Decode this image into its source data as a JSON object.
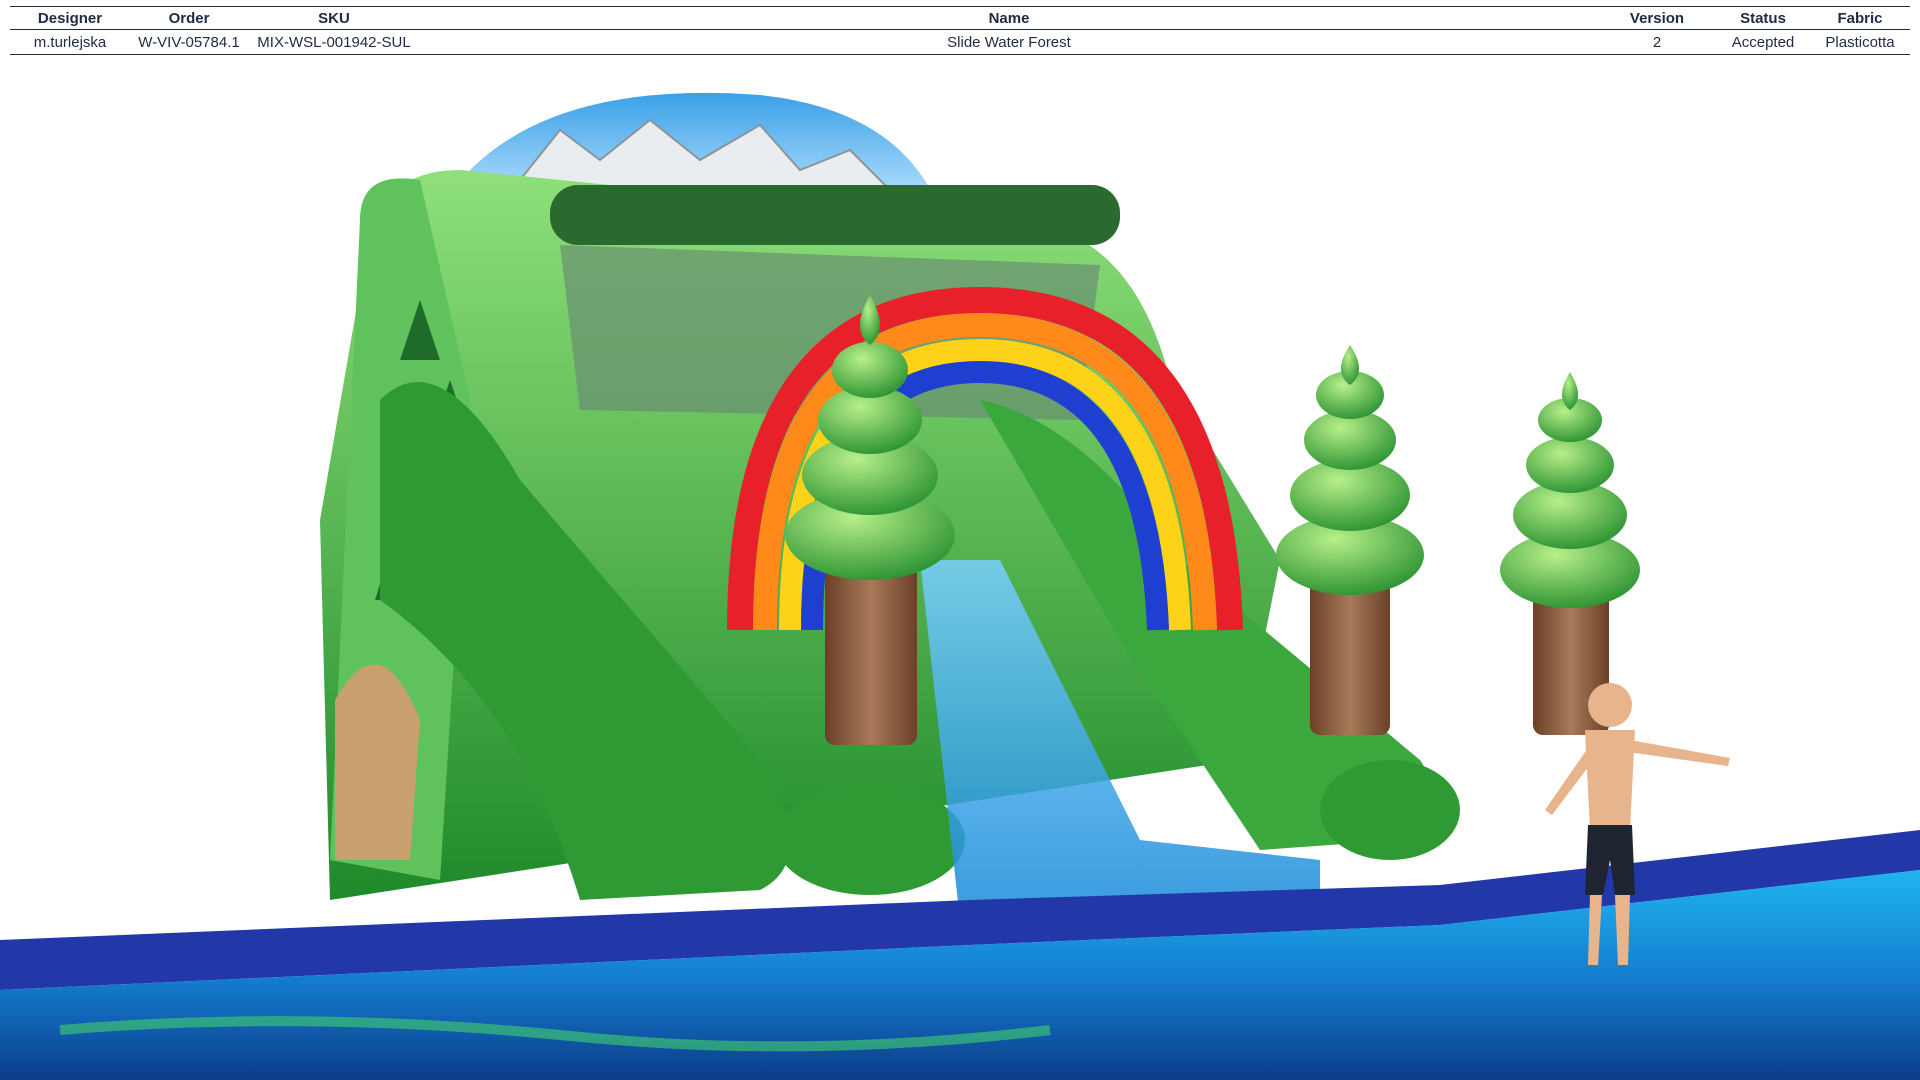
{
  "table": {
    "headers": {
      "designer": "Designer",
      "order": "Order",
      "sku": "SKU",
      "name": "Name",
      "version": "Version",
      "status": "Status",
      "fabric": "Fabric"
    },
    "row": {
      "designer": "m.turlejska",
      "order": "W-VIV-05784.1",
      "sku": "MIX-WSL-001942-SUL",
      "name": "Slide Water Forest",
      "version": "2",
      "status": "Accepted",
      "fabric": "Plasticotta"
    }
  },
  "colors": {
    "header_text": "#1f2a44",
    "slide_green": "#3cb43c",
    "pool_blue": "#1e3fa0",
    "water": "#1aa0e0",
    "tree_trunk": "#8a5a3c"
  }
}
